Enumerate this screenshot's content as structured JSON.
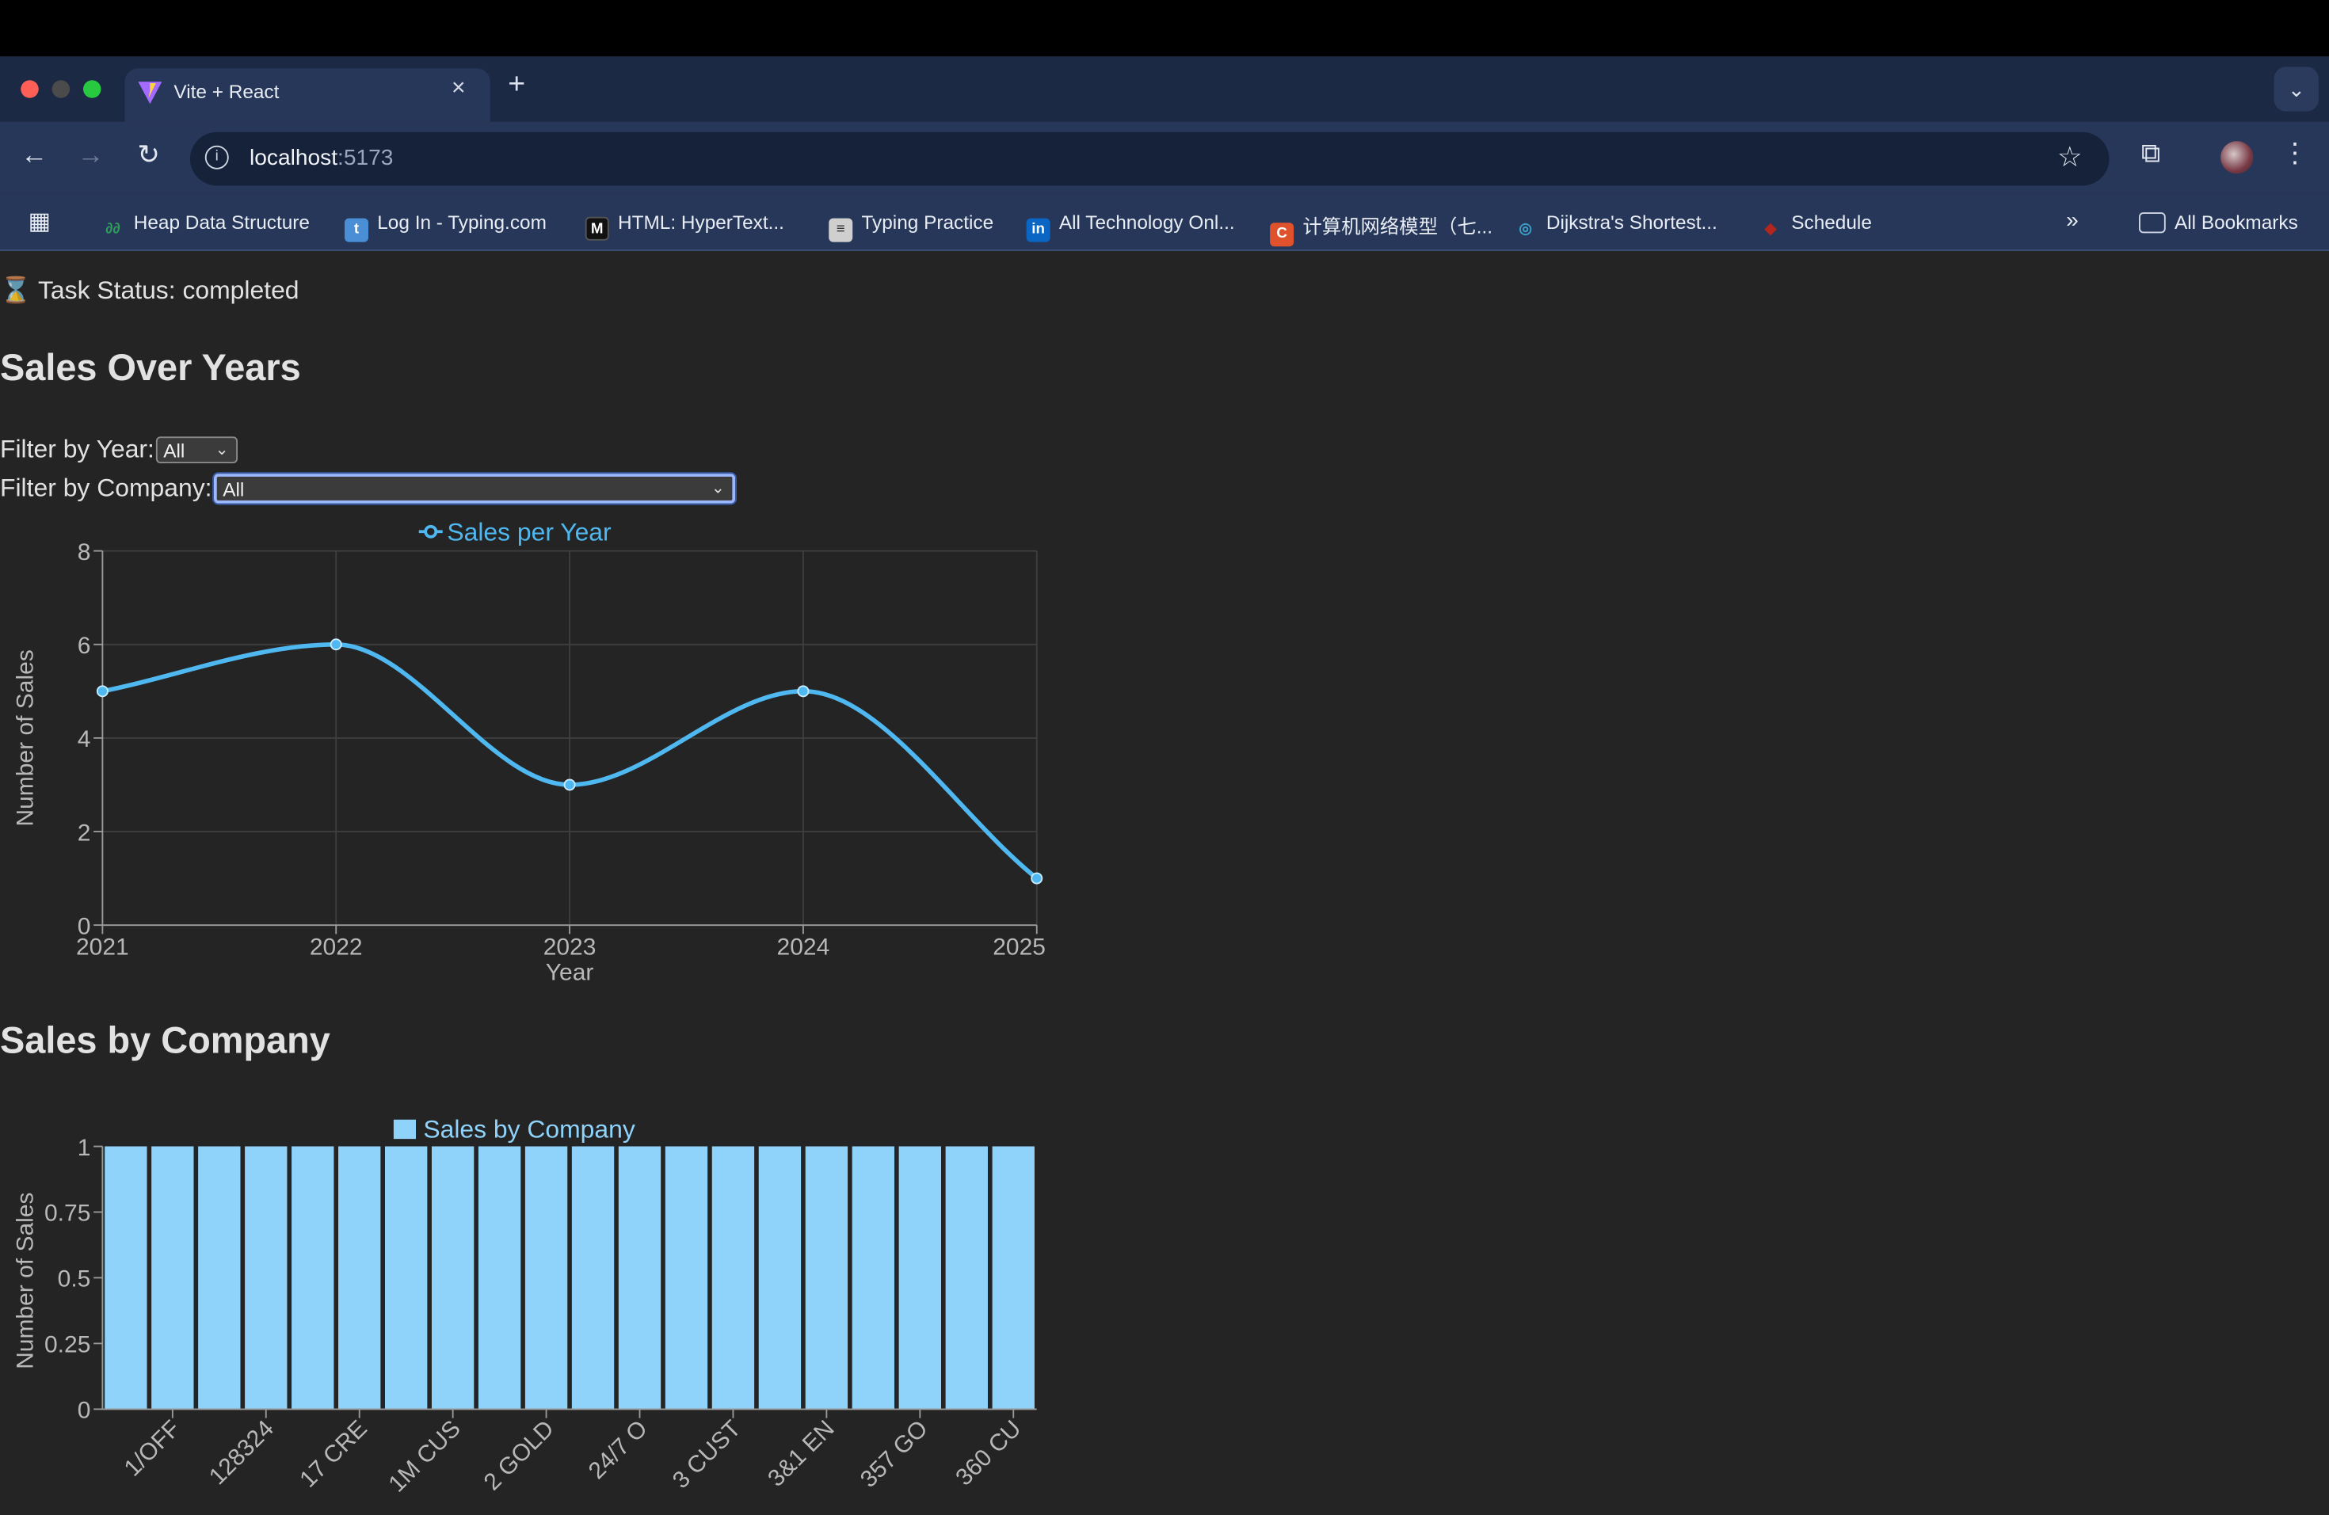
{
  "browser": {
    "tab_title": "Vite + React",
    "url_host": "localhost",
    "url_port": ":5173",
    "bookmarks": [
      {
        "label": "Heap Data Structure",
        "icon": "heap-favicon",
        "color": "#2e9e5b"
      },
      {
        "label": "Log In - Typing.com",
        "icon": "typing-favicon",
        "color": "#4a8fd6"
      },
      {
        "label": "HTML: HyperText...",
        "icon": "mdn-favicon",
        "color": "#111111"
      },
      {
        "label": "Typing Practice",
        "icon": "typing-practice-favicon",
        "color": "#cfcfcf"
      },
      {
        "label": "All Technology Onl...",
        "icon": "linkedin-favicon",
        "color": "#0a66c2"
      },
      {
        "label": "计算机网络模型（七...",
        "icon": "csdn-favicon",
        "color": "#e0522b"
      },
      {
        "label": "Dijkstra's Shortest...",
        "icon": "dijkstra-favicon",
        "color": "#3aa0c8"
      },
      {
        "label": "Schedule",
        "icon": "schedule-favicon",
        "color": "#b3261e"
      }
    ],
    "all_bookmarks": "All Bookmarks"
  },
  "page": {
    "status_icon": "⌛",
    "status_text": "Task Status: completed",
    "line_heading": "Sales Over Years",
    "bar_heading": "Sales by Company",
    "filter_year_label": "Filter by Year:",
    "filter_year_value": "All",
    "filter_company_label": "Filter by Company:",
    "filter_company_value": "All"
  },
  "chart_data": [
    {
      "type": "line",
      "legend": "Sales per Year",
      "x": [
        "2021",
        "2022",
        "2023",
        "2024",
        "2025"
      ],
      "values": [
        5,
        6,
        3,
        5,
        1
      ],
      "xlabel": "Year",
      "ylabel": "Number of Sales",
      "ylim": [
        0,
        8
      ],
      "yticks": [
        "0",
        "2",
        "4",
        "6",
        "8"
      ],
      "grid": true,
      "color": "#4fb8f0",
      "legend_position": "top-center"
    },
    {
      "type": "bar",
      "legend": "Sales by Company",
      "bar_count": 20,
      "values": [
        1,
        1,
        1,
        1,
        1,
        1,
        1,
        1,
        1,
        1,
        1,
        1,
        1,
        1,
        1,
        1,
        1,
        1,
        1,
        1
      ],
      "tick_labels": [
        "1/OFF",
        "128324",
        "17 CRE",
        "1M CUS",
        "2 GOLD",
        "24/7 O",
        "3 CUST",
        "3&1 EN",
        "357 GO",
        "360 CU"
      ],
      "xlabel": "",
      "ylabel": "Number of Sales",
      "ylim": [
        0,
        1
      ],
      "yticks": [
        "0",
        "0.25",
        "0.5",
        "0.75",
        "1"
      ],
      "color": "#8fd3fb",
      "legend_position": "top-center"
    }
  ]
}
